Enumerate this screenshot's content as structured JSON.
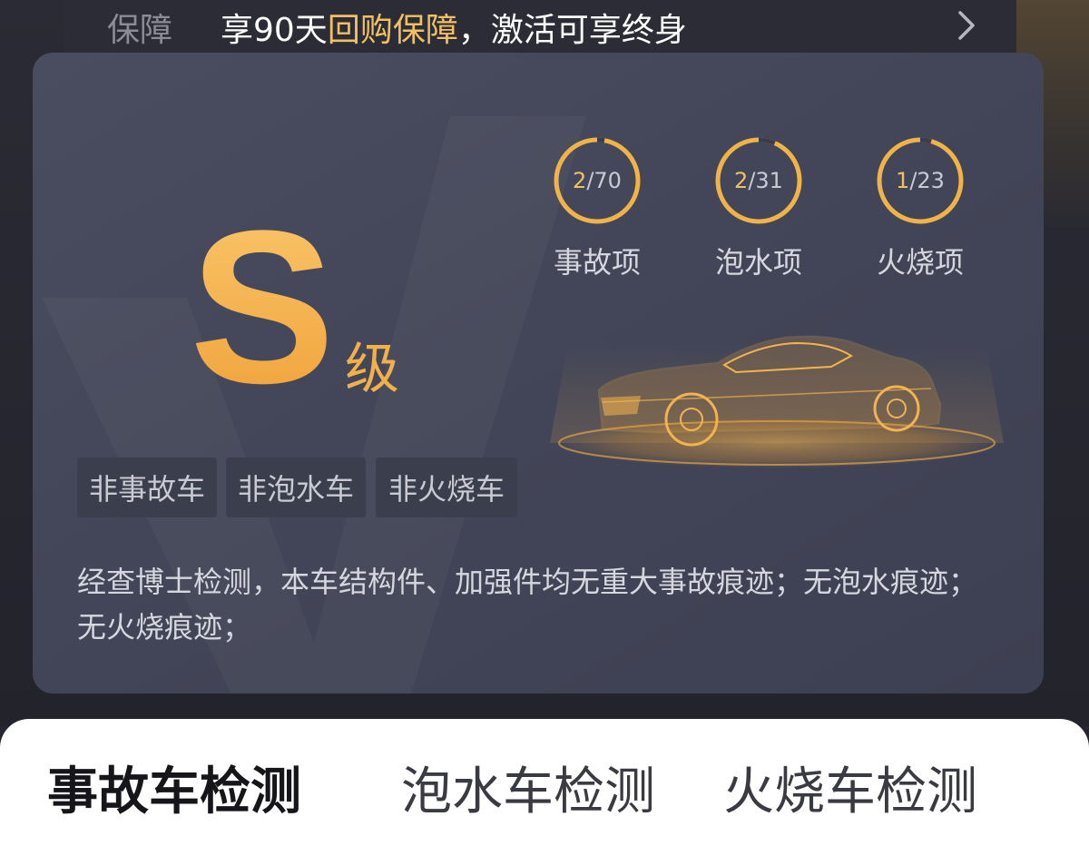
{
  "guarantee": {
    "label": "保障",
    "text_prefix": "享90天",
    "text_highlight": "回购保障",
    "text_suffix": "，激活可享终身",
    "chevron_icon": "chevron-right-icon"
  },
  "report": {
    "grade_letter": "S",
    "grade_suffix": "级",
    "rings": [
      {
        "found": "2",
        "total": "/70",
        "ratio": 0.0286,
        "label": "事故项"
      },
      {
        "found": "2",
        "total": "/31",
        "ratio": 0.0645,
        "label": "泡水项"
      },
      {
        "found": "1",
        "total": "/23",
        "ratio": 0.0435,
        "label": "火烧项"
      }
    ],
    "tags": [
      "非事故车",
      "非泡水车",
      "非火烧车"
    ],
    "description": "经查博士检测，本车结构件、加强件均无重大事故痕迹；无泡水痕迹；无火烧痕迹；",
    "car_icon": "car-illustration-icon"
  },
  "tabs": [
    {
      "label": "事故车检测",
      "active": true
    },
    {
      "label": "泡水车检测",
      "active": false
    },
    {
      "label": "火烧车检测",
      "active": false
    }
  ],
  "colors": {
    "accent": "#f0c063",
    "grade": "#f0a23a",
    "card_bg": "#45485a",
    "page_bg": "#262630"
  }
}
